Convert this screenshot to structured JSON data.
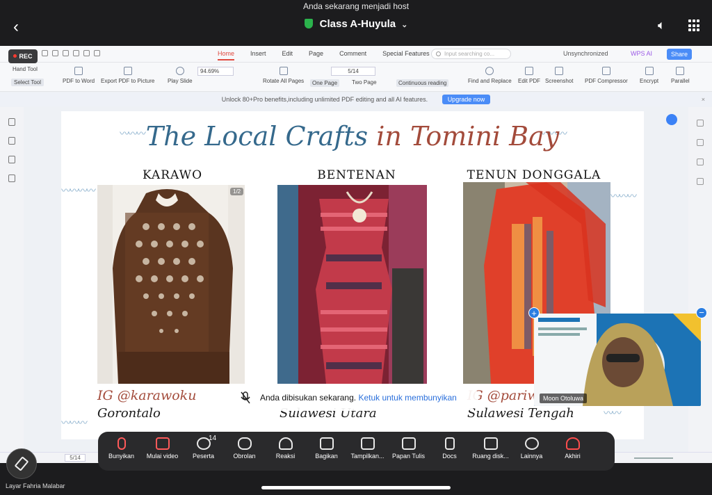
{
  "notice": "Anda sekarang menjadi host",
  "meeting": {
    "title": "Class A-Huyula"
  },
  "share": {
    "rec_label": "REC",
    "menu_tabs": [
      "Home",
      "Insert",
      "Edit",
      "Page",
      "Comment",
      "Special Features"
    ],
    "search_placeholder": "Input searching co...",
    "unsync_label": "Unsynchronized",
    "wps_ai_label": "WPS AI",
    "share_label": "Share",
    "toolbar": {
      "hand_tool": "Hand Tool",
      "select_tool": "Select Tool",
      "pdf_to_word": "PDF to Word",
      "export_pdf_picture": "Export PDF to Picture",
      "play_slide": "Play Slide",
      "zoom": "94.69%",
      "rotate_all": "Rotate All Pages",
      "page_value": "5/14",
      "one_page": "One Page",
      "two_page": "Two Page",
      "continuous": "Continuous reading",
      "find_replace": "Find and Replace",
      "edit_pdf": "Edit PDF",
      "screenshot": "Screenshot",
      "pdf_compressor": "PDF Compressor",
      "encrypt": "Encrypt",
      "parallel": "Parallel"
    },
    "promo_text": "Unlock 80+Pro benefits,including unlimited PDF editing and all AI features.",
    "upgrade_label": "Upgrade now",
    "status_page": "5/14"
  },
  "slide": {
    "title_main": "The Local Crafts",
    "title_in": "in Tomini Bay",
    "page_indicator": "1/2",
    "sections": [
      {
        "name": "KARAWO",
        "ig": "IG @karawoku",
        "region": "Gorontalo"
      },
      {
        "name": "BENTENAN",
        "ig": "",
        "region": "Sulawesi Utara"
      },
      {
        "name": "TENUN DONGGALA",
        "ig": "IG @pariwi",
        "region": "Sulawesi Tengah"
      }
    ]
  },
  "toast": {
    "text": "Anda dibisukan sekarang.",
    "link": "Ketuk untuk membunyikan"
  },
  "video": {
    "name": "Moon Otoluwa"
  },
  "toolbar": {
    "items": [
      {
        "label": "Bunyikan",
        "icon": "mic-icon"
      },
      {
        "label": "Mulai video",
        "icon": "video-off-icon"
      },
      {
        "label": "Peserta",
        "icon": "participants-icon",
        "badge": "14"
      },
      {
        "label": "Obrolan",
        "icon": "chat-icon"
      },
      {
        "label": "Reaksi",
        "icon": "heart-icon"
      },
      {
        "label": "Bagikan",
        "icon": "share-icon"
      },
      {
        "label": "Tampilkan...",
        "icon": "cc-icon"
      },
      {
        "label": "Papan Tulis",
        "icon": "whiteboard-icon"
      },
      {
        "label": "Docs",
        "icon": "docs-icon"
      },
      {
        "label": "Ruang disk...",
        "icon": "breakout-icon"
      },
      {
        "label": "Lainnya",
        "icon": "more-icon"
      },
      {
        "label": "Akhiri",
        "icon": "end-icon"
      }
    ]
  },
  "sharer": "Layar Fahria Malabar",
  "colors": {
    "title_blue": "#35698c",
    "title_red": "#a34b3b",
    "accent_blue": "#4a8cf7",
    "toolbar_bg": "#2a2a2c"
  }
}
